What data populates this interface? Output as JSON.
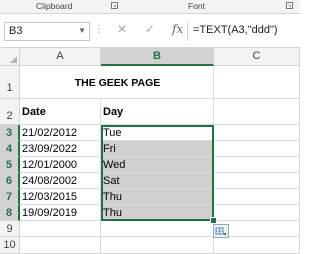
{
  "ribbon": {
    "clipboard_label": "Clipboard",
    "font_label": "Font",
    "launcher_glyph": "↘"
  },
  "formula_bar": {
    "name_box": "B3",
    "cancel_icon": "✕",
    "enter_icon": "✓",
    "fx_label": "fx",
    "formula": "=TEXT(A3,\"ddd\")"
  },
  "sheet": {
    "columns": [
      "A",
      "B",
      "C"
    ],
    "selected_column": "B",
    "rows": [
      "1",
      "2",
      "3",
      "4",
      "5",
      "6",
      "7",
      "8",
      "9",
      "10"
    ],
    "title": "THE GEEK PAGE",
    "headers": {
      "date": "Date",
      "day": "Day"
    },
    "data": [
      {
        "date": "21/02/2012",
        "day": "Tue"
      },
      {
        "date": "23/09/2022",
        "day": "Fri"
      },
      {
        "date": "12/01/2000",
        "day": "Wed"
      },
      {
        "date": "24/08/2002",
        "day": "Sat"
      },
      {
        "date": "12/03/2015",
        "day": "Thu"
      },
      {
        "date": "19/09/2019",
        "day": "Thu"
      }
    ]
  },
  "colors": {
    "accent": "#217346",
    "selected_fill": "#d0d0d0"
  }
}
